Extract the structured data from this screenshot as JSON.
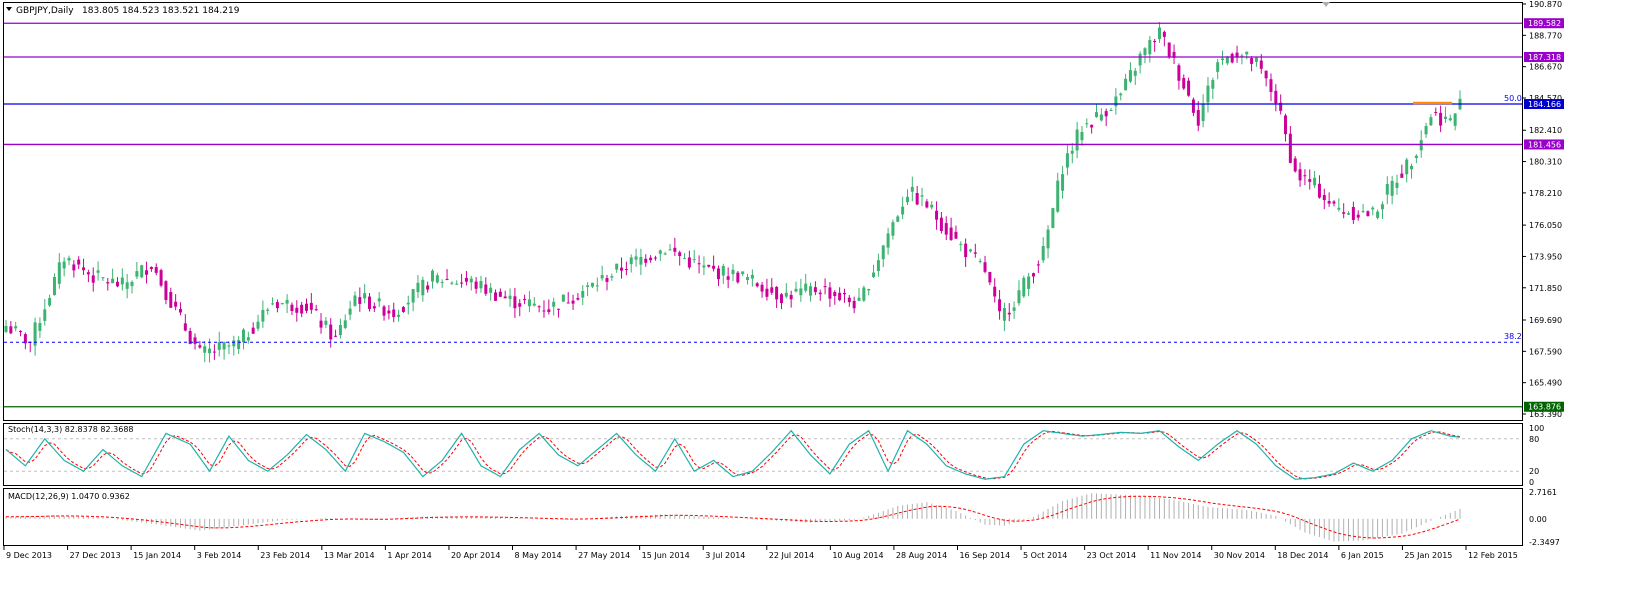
{
  "header": {
    "symbol_label": "GBPJPY,Daily",
    "ohlc": "183.805 184.523 183.521 184.219",
    "menu_icon": "triangle-down-icon"
  },
  "price_axis": {
    "ticks": [
      "190.870",
      "188.770",
      "186.670",
      "184.570",
      "182.410",
      "180.310",
      "178.210",
      "176.050",
      "173.950",
      "171.850",
      "169.690",
      "167.590",
      "165.490",
      "163.390"
    ]
  },
  "levels": [
    {
      "label": "189.582",
      "price": 189.582,
      "color": "#9900cc"
    },
    {
      "label": "187.318",
      "price": 187.318,
      "color": "#9900cc"
    },
    {
      "label": "184.166",
      "price": 184.166,
      "color": "#0000cc"
    },
    {
      "label": "181.456",
      "price": 181.456,
      "color": "#9900cc"
    },
    {
      "label": "163.876",
      "price": 163.876,
      "color": "#006400"
    }
  ],
  "fibo": [
    {
      "label": "50.0",
      "price": 184.166
    },
    {
      "label": "38.2",
      "price": 168.2
    }
  ],
  "stoch": {
    "label": "Stoch(14,3,3) 82.8378 82.3688",
    "ticks": [
      "100",
      "80",
      "20",
      "0"
    ]
  },
  "macd": {
    "label": "MACD(12,26,9) 1.0470 0.9362",
    "ticks": [
      "2.7161",
      "0.00",
      "-2.3497"
    ]
  },
  "dates": [
    "9 Dec 2013",
    "27 Dec 2013",
    "15 Jan 2014",
    "3 Feb 2014",
    "23 Feb 2014",
    "13 Mar 2014",
    "1 Apr 2014",
    "20 Apr 2014",
    "8 May 2014",
    "27 May 2014",
    "15 Jun 2014",
    "3 Jul 2014",
    "22 Jul 2014",
    "10 Aug 2014",
    "28 Aug 2014",
    "16 Sep 2014",
    "5 Oct 2014",
    "23 Oct 2014",
    "11 Nov 2014",
    "30 Nov 2014",
    "18 Dec 2014",
    "6 Jan 2015",
    "25 Jan 2015",
    "12 Feb 2015"
  ],
  "colors": {
    "bull": "#3cb371",
    "bear": "#cc0099",
    "stoch_main": "#20b2aa",
    "stoch_signal": "#ff0000",
    "macd_hist": "#b0b0b0",
    "macd_signal": "#ff0000"
  },
  "chart_data": {
    "type": "candlestick",
    "close_anchors": [
      [
        0,
        169.3
      ],
      [
        5,
        168.2
      ],
      [
        12,
        173.9
      ],
      [
        18,
        172.6
      ],
      [
        24,
        172.0
      ],
      [
        30,
        173.5
      ],
      [
        35,
        170.3
      ],
      [
        40,
        167.4
      ],
      [
        48,
        168.1
      ],
      [
        55,
        170.9
      ],
      [
        62,
        170.6
      ],
      [
        68,
        168.4
      ],
      [
        72,
        171.3
      ],
      [
        80,
        170.2
      ],
      [
        88,
        172.5
      ],
      [
        96,
        172.2
      ],
      [
        104,
        171.0
      ],
      [
        112,
        170.5
      ],
      [
        120,
        171.8
      ],
      [
        128,
        173.4
      ],
      [
        136,
        174.5
      ],
      [
        144,
        173.1
      ],
      [
        152,
        172.6
      ],
      [
        160,
        171.3
      ],
      [
        168,
        171.8
      ],
      [
        176,
        170.7
      ],
      [
        182,
        175.5
      ],
      [
        186,
        178.3
      ],
      [
        190,
        177.4
      ],
      [
        196,
        175.0
      ],
      [
        202,
        173.0
      ],
      [
        205,
        169.8
      ],
      [
        208,
        171.0
      ],
      [
        214,
        174.2
      ],
      [
        218,
        180.0
      ],
      [
        222,
        182.6
      ],
      [
        226,
        183.5
      ],
      [
        230,
        184.8
      ],
      [
        234,
        187.3
      ],
      [
        238,
        189.0
      ],
      [
        242,
        186.2
      ],
      [
        246,
        183.2
      ],
      [
        250,
        187.0
      ],
      [
        254,
        187.6
      ],
      [
        258,
        186.8
      ],
      [
        262,
        184.5
      ],
      [
        266,
        179.5
      ],
      [
        270,
        178.7
      ],
      [
        274,
        177.2
      ],
      [
        278,
        176.9
      ],
      [
        282,
        176.8
      ],
      [
        286,
        178.8
      ],
      [
        290,
        180.5
      ],
      [
        294,
        183.5
      ],
      [
        298,
        183.0
      ],
      [
        300,
        184.2
      ]
    ],
    "stoch_main_anchors": [
      [
        0,
        60
      ],
      [
        4,
        30
      ],
      [
        8,
        80
      ],
      [
        12,
        40
      ],
      [
        16,
        20
      ],
      [
        20,
        60
      ],
      [
        24,
        30
      ],
      [
        28,
        10
      ],
      [
        33,
        90
      ],
      [
        38,
        70
      ],
      [
        42,
        20
      ],
      [
        46,
        85
      ],
      [
        50,
        40
      ],
      [
        54,
        20
      ],
      [
        58,
        50
      ],
      [
        62,
        88
      ],
      [
        66,
        60
      ],
      [
        70,
        20
      ],
      [
        74,
        90
      ],
      [
        78,
        75
      ],
      [
        82,
        55
      ],
      [
        86,
        10
      ],
      [
        90,
        40
      ],
      [
        94,
        90
      ],
      [
        98,
        30
      ],
      [
        102,
        10
      ],
      [
        106,
        60
      ],
      [
        110,
        90
      ],
      [
        114,
        50
      ],
      [
        118,
        30
      ],
      [
        122,
        60
      ],
      [
        126,
        90
      ],
      [
        130,
        50
      ],
      [
        134,
        20
      ],
      [
        138,
        80
      ],
      [
        142,
        20
      ],
      [
        146,
        40
      ],
      [
        150,
        10
      ],
      [
        154,
        20
      ],
      [
        158,
        55
      ],
      [
        162,
        95
      ],
      [
        166,
        50
      ],
      [
        170,
        15
      ],
      [
        174,
        70
      ],
      [
        178,
        95
      ],
      [
        182,
        20
      ],
      [
        186,
        95
      ],
      [
        190,
        70
      ],
      [
        194,
        30
      ],
      [
        198,
        15
      ],
      [
        202,
        5
      ],
      [
        206,
        10
      ],
      [
        210,
        70
      ],
      [
        214,
        95
      ],
      [
        218,
        90
      ],
      [
        222,
        85
      ],
      [
        226,
        88
      ],
      [
        230,
        92
      ],
      [
        234,
        90
      ],
      [
        238,
        95
      ],
      [
        242,
        65
      ],
      [
        246,
        40
      ],
      [
        250,
        70
      ],
      [
        254,
        95
      ],
      [
        258,
        70
      ],
      [
        262,
        30
      ],
      [
        266,
        5
      ],
      [
        270,
        8
      ],
      [
        274,
        15
      ],
      [
        278,
        35
      ],
      [
        282,
        20
      ],
      [
        286,
        40
      ],
      [
        290,
        80
      ],
      [
        294,
        95
      ],
      [
        298,
        85
      ],
      [
        300,
        83
      ]
    ],
    "macd_anchors": [
      [
        0,
        0.2
      ],
      [
        10,
        0.35
      ],
      [
        20,
        0.1
      ],
      [
        30,
        -0.5
      ],
      [
        40,
        -1.2
      ],
      [
        48,
        -0.7
      ],
      [
        56,
        -0.2
      ],
      [
        66,
        0.1
      ],
      [
        76,
        -0.1
      ],
      [
        86,
        0.25
      ],
      [
        96,
        0.2
      ],
      [
        106,
        0.05
      ],
      [
        116,
        -0.1
      ],
      [
        126,
        0.25
      ],
      [
        136,
        0.45
      ],
      [
        146,
        0.15
      ],
      [
        156,
        -0.1
      ],
      [
        166,
        -0.4
      ],
      [
        176,
        -0.05
      ],
      [
        184,
        1.3
      ],
      [
        190,
        1.7
      ],
      [
        196,
        0.8
      ],
      [
        202,
        -0.6
      ],
      [
        206,
        -0.7
      ],
      [
        212,
        0.2
      ],
      [
        218,
        1.8
      ],
      [
        224,
        2.6
      ],
      [
        232,
        2.4
      ],
      [
        240,
        2.0
      ],
      [
        248,
        1.2
      ],
      [
        256,
        0.9
      ],
      [
        262,
        0.3
      ],
      [
        268,
        -1.4
      ],
      [
        274,
        -2.3
      ],
      [
        280,
        -2.2
      ],
      [
        288,
        -1.5
      ],
      [
        294,
        -0.2
      ],
      [
        300,
        1.0
      ]
    ]
  }
}
